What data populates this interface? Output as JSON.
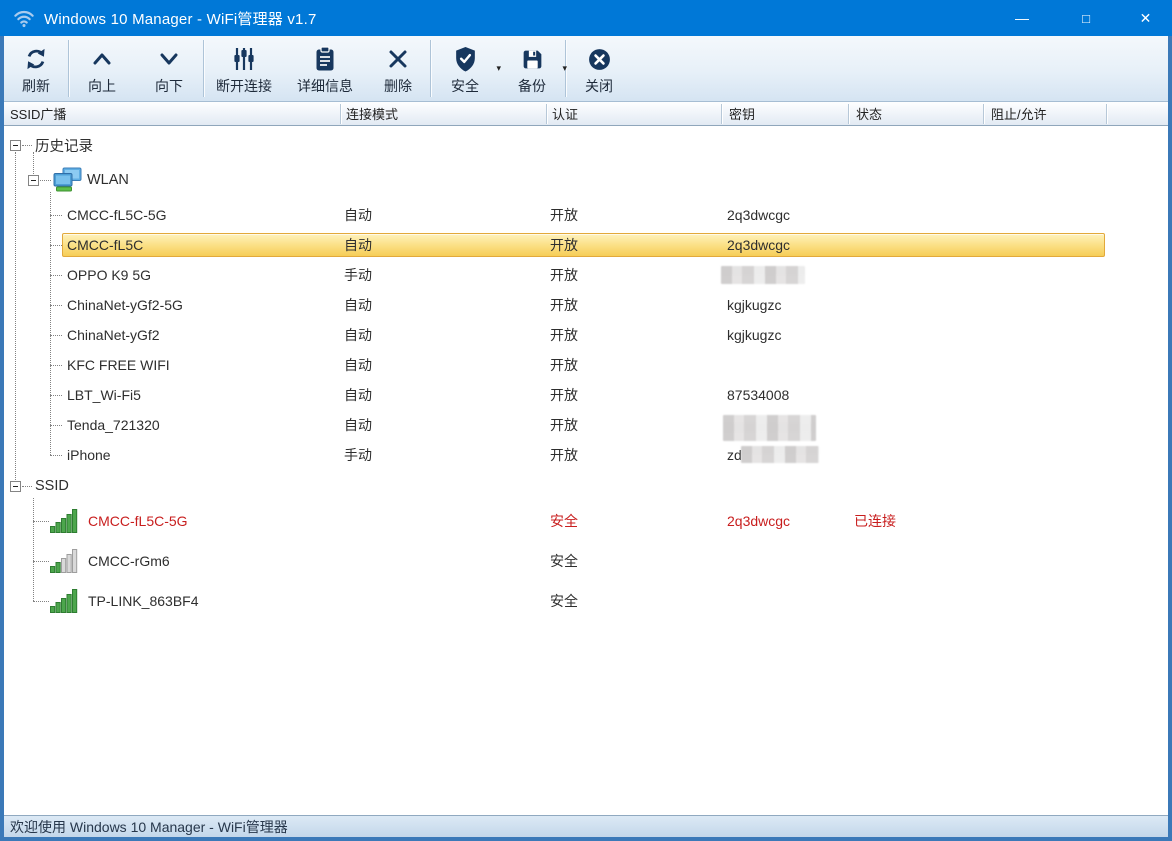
{
  "titlebar": {
    "title": "Windows 10 Manager - WiFi管理器 v1.7",
    "minimize_glyph": "—",
    "maximize_glyph": "□",
    "close_glyph": "✕"
  },
  "toolbar": {
    "dropdown_glyph": "▾",
    "buttons": [
      {
        "label": "刷新",
        "icon": "refresh-icon"
      },
      {
        "label": "向上",
        "icon": "chevron-up-icon"
      },
      {
        "label": "向下",
        "icon": "chevron-down-icon"
      },
      {
        "label": "断开连接",
        "icon": "sliders-icon"
      },
      {
        "label": "详细信息",
        "icon": "clipboard-icon"
      },
      {
        "label": "删除",
        "icon": "delete-x-icon"
      },
      {
        "label": "安全",
        "icon": "shield-check-icon",
        "has_dropdown": true
      },
      {
        "label": "备份",
        "icon": "floppy-disk-icon",
        "has_dropdown": true
      },
      {
        "label": "关闭",
        "icon": "close-circle-icon"
      }
    ]
  },
  "columns": [
    {
      "label": "SSID广播"
    },
    {
      "label": "连接模式"
    },
    {
      "label": "认证"
    },
    {
      "label": "密钥"
    },
    {
      "label": "状态"
    },
    {
      "label": "阻止/允许"
    }
  ],
  "tree": {
    "history": {
      "label": "历史记录",
      "adapter": {
        "label": "WLAN",
        "icon": "network-adapter-icon"
      },
      "networks": [
        {
          "name": "CMCC-fL5C-5G",
          "mode": "自动",
          "auth": "开放",
          "key": "2q3dwcgc"
        },
        {
          "name": "CMCC-fL5C",
          "mode": "自动",
          "auth": "开放",
          "key": "2q3dwcgc",
          "selected": true
        },
        {
          "name": "OPPO K9 5G",
          "mode": "手动",
          "auth": "开放",
          "key": "",
          "key_redacted": true
        },
        {
          "name": "ChinaNet-yGf2-5G",
          "mode": "自动",
          "auth": "开放",
          "key": "kgjkugzc"
        },
        {
          "name": "ChinaNet-yGf2",
          "mode": "自动",
          "auth": "开放",
          "key": "kgjkugzc"
        },
        {
          "name": "KFC FREE WIFI",
          "mode": "自动",
          "auth": "开放",
          "key": ""
        },
        {
          "name": "LBT_Wi-Fi5",
          "mode": "自动",
          "auth": "开放",
          "key": "87534008"
        },
        {
          "name": "Tenda_721320",
          "mode": "自动",
          "auth": "开放",
          "key": "",
          "key_redacted": true
        },
        {
          "name": "iPhone",
          "mode": "手动",
          "auth": "开放",
          "key": "zd",
          "key_redacted": true
        }
      ]
    },
    "ssid": {
      "label": "SSID",
      "networks": [
        {
          "name": "CMCC-fL5C-5G",
          "auth": "安全",
          "key": "2q3dwcgc",
          "status": "已连接",
          "signal": "strong",
          "connected": true
        },
        {
          "name": "CMCC-rGm6",
          "auth": "安全",
          "key": "",
          "status": "",
          "signal": "weak"
        },
        {
          "name": "TP-LINK_863BF4",
          "auth": "安全",
          "key": "",
          "status": "",
          "signal": "strong"
        }
      ]
    }
  },
  "statusbar": {
    "text": "欢迎使用 Windows 10 Manager - WiFi管理器"
  },
  "colors": {
    "titlebar_bg": "#0078D7",
    "window_border": "#3B79B8",
    "toolbar_icon": "#17375E",
    "selected_row_top": "#FEF2BE",
    "selected_row_bottom": "#F6CD57",
    "selected_row_border": "#E2A93B",
    "connected_text": "#C81E1E",
    "signal_green": "#4CA64C",
    "signal_gray": "#D6D6D6"
  }
}
